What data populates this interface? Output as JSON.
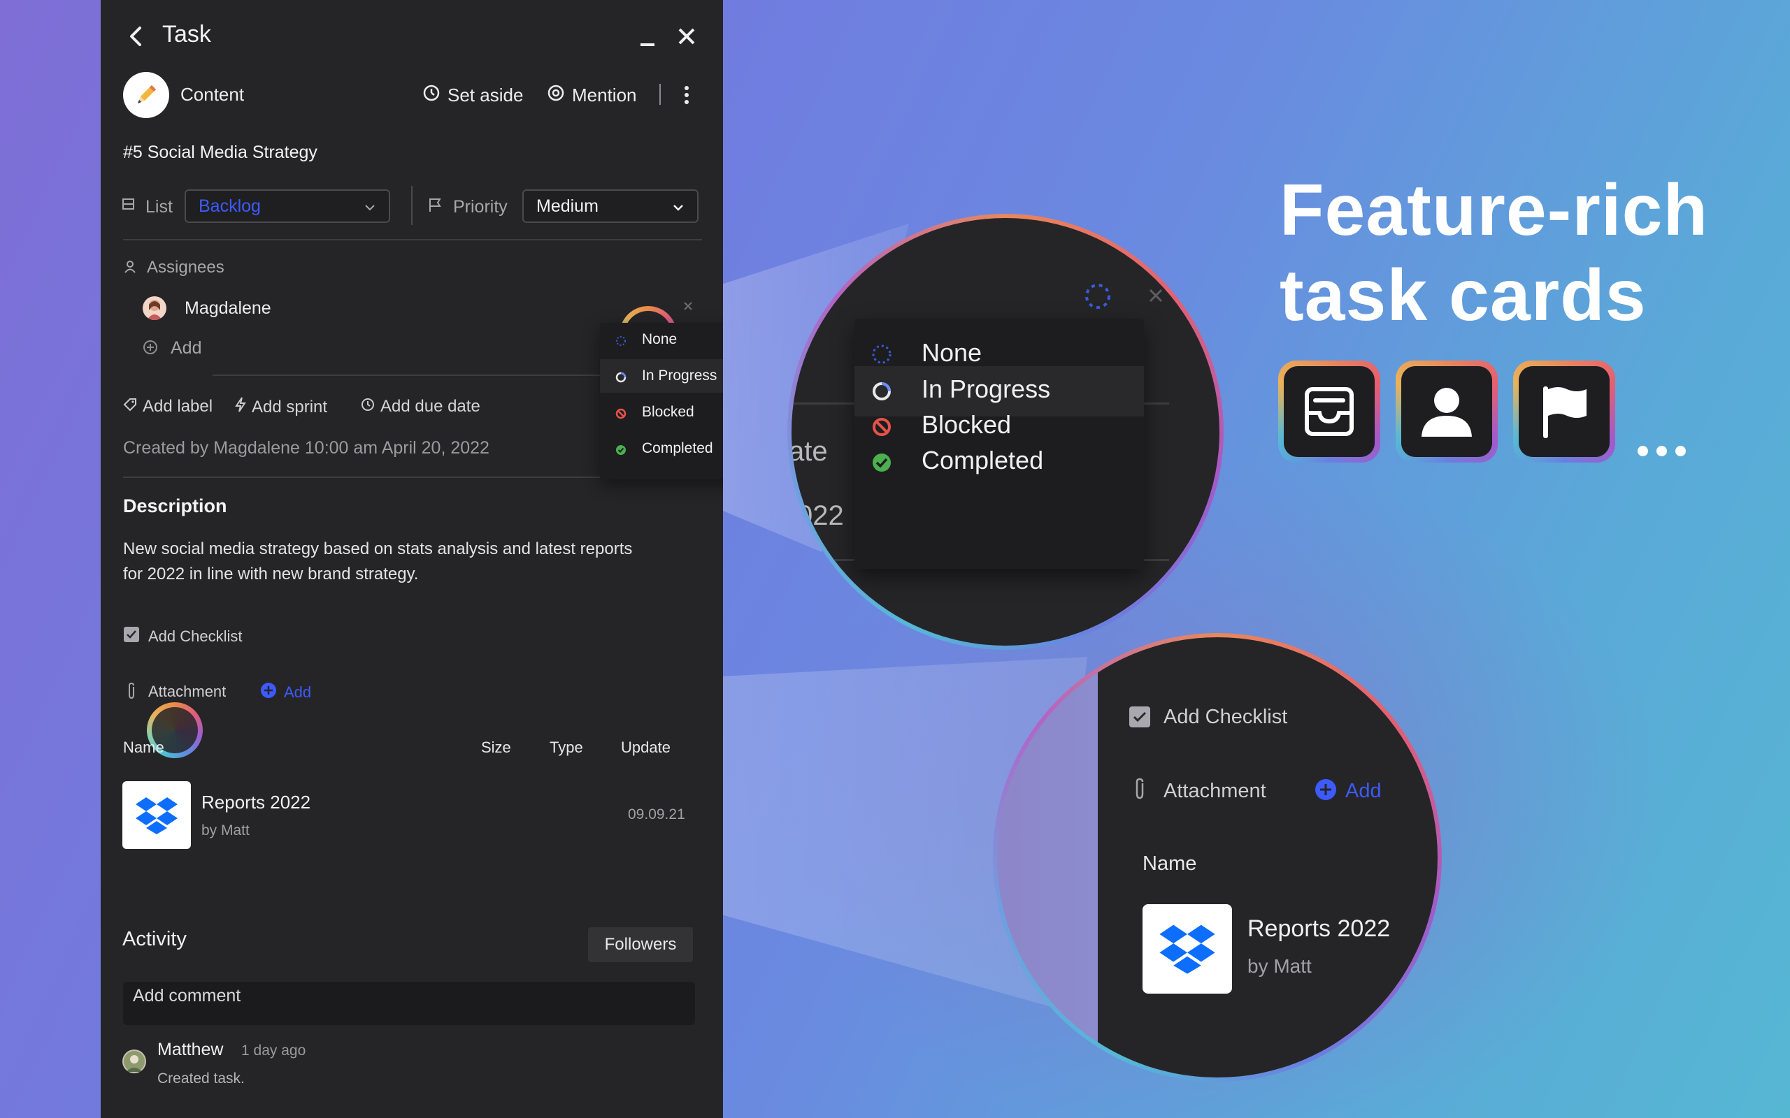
{
  "panel": {
    "title": "Task",
    "content_label": "Content",
    "set_aside": "Set aside",
    "mention": "Mention",
    "task_name": "#5 Social Media Strategy",
    "list_label": "List",
    "list_value": "Backlog",
    "priority_label": "Priority",
    "priority_value": "Medium",
    "assignees_label": "Assignees",
    "assignee_name": "Magdalene",
    "add_assignee": "Add",
    "add_label": "Add label",
    "add_sprint": "Add sprint",
    "add_due_date": "Add due date",
    "created_by": "Created by Magdalene 10:00 am April 20, 2022",
    "description_heading": "Description",
    "description_line1": "New social media strategy based on stats analysis and latest reports",
    "description_line2": "for 2022 in line with new brand strategy.",
    "add_checklist": "Add Checklist",
    "attachment_label": "Attachment",
    "attachment_add": "Add",
    "table_headers": {
      "name": "Name",
      "size": "Size",
      "type": "Type",
      "update": "Update"
    },
    "file": {
      "name": "Reports 2022",
      "owner": "by Matt",
      "updated": "09.09.21"
    },
    "activity_heading": "Activity",
    "followers_button": "Followers",
    "comment_placeholder": "Add comment",
    "activity_item": {
      "user": "Matthew",
      "time": "1 day ago",
      "text": "Created task."
    }
  },
  "status_menu": {
    "items": [
      {
        "label": "None",
        "icon": "dotted-circle-icon",
        "color": "#3b5bdb"
      },
      {
        "label": "In Progress",
        "icon": "progress-circle-icon",
        "color": "#6b8cff"
      },
      {
        "label": "Blocked",
        "icon": "blocked-icon",
        "color": "#e5534b"
      },
      {
        "label": "Completed",
        "icon": "check-circle-icon",
        "color": "#4caf50"
      }
    ]
  },
  "zoom_top": {
    "items": [
      "None",
      "In Progress",
      "Blocked",
      "Completed"
    ],
    "fragment_a": "ate",
    "fragment_b": "022"
  },
  "zoom_bottom": {
    "add_checklist": "Add Checklist",
    "attachment_label": "Attachment",
    "attachment_add": "Add",
    "name_header": "Name",
    "file_name": "Reports 2022",
    "file_owner": "by Matt"
  },
  "promo": {
    "headline_line1": "Feature-rich",
    "headline_line2": "task cards",
    "icons": [
      "inbox-tray-icon",
      "person-icon",
      "flag-icon"
    ],
    "more": "..."
  },
  "colors": {
    "accent_blue": "#3d5afe",
    "panel_bg": "#252527",
    "blocked_red": "#e5534b",
    "completed_green": "#4caf50"
  }
}
